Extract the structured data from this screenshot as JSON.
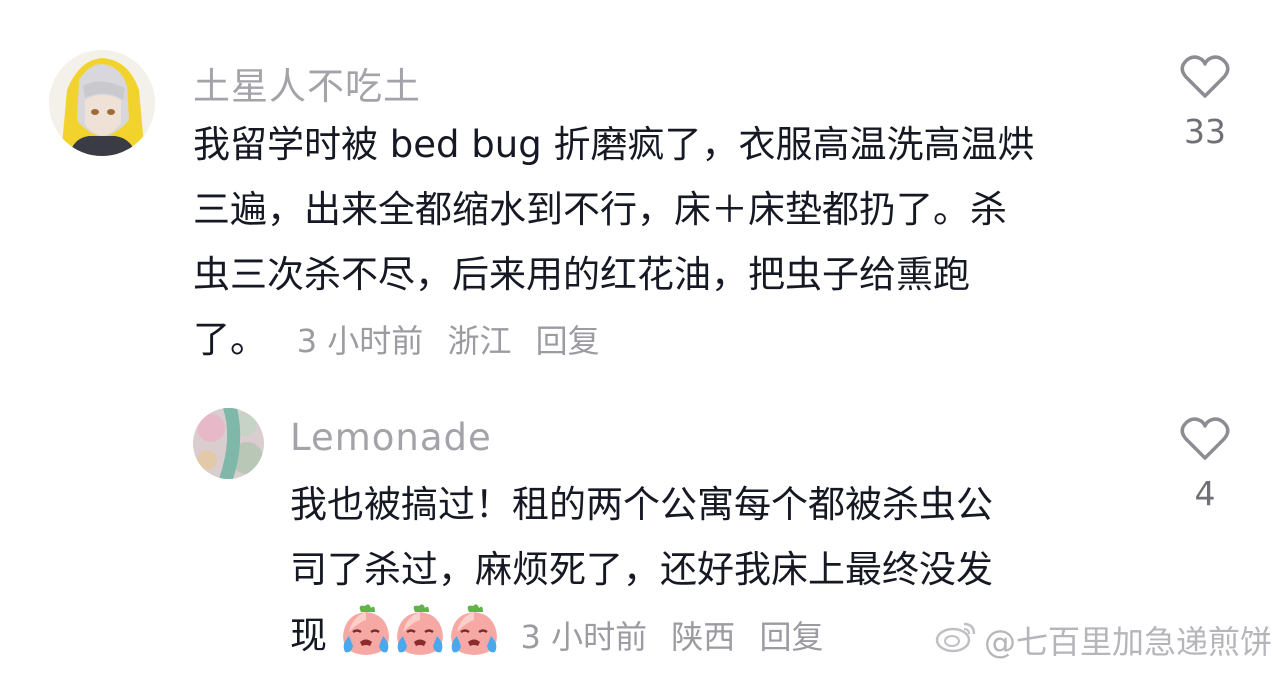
{
  "comments": [
    {
      "username": "土星人不吃土",
      "lines": [
        "我留学时被 bed bug 折磨疯了，衣服高温洗高温烘",
        "三遍，出来全都缩水到不行，床＋床垫都扔了。杀",
        "虫三次杀不尽，后来用的红花油，把虫子给熏跑",
        "了。"
      ],
      "time": "3 小时前",
      "location": "浙江",
      "reply_label": "回复",
      "likes": "33"
    },
    {
      "username": "Lemonade",
      "lines": [
        "我也被搞过！租的两个公寓每个都被杀虫公",
        "司了杀过，麻烦死了，还好我床上最终没发",
        "现"
      ],
      "emoji_icon": "crying-peach-emoji",
      "time": "3 小时前",
      "location": "陕西",
      "reply_label": "回复",
      "likes": "4"
    }
  ],
  "watermark": "@七百里加急递煎饼",
  "colors": {
    "text": "#161823",
    "username": "#a3a3a9",
    "meta": "#9b9ba1"
  }
}
